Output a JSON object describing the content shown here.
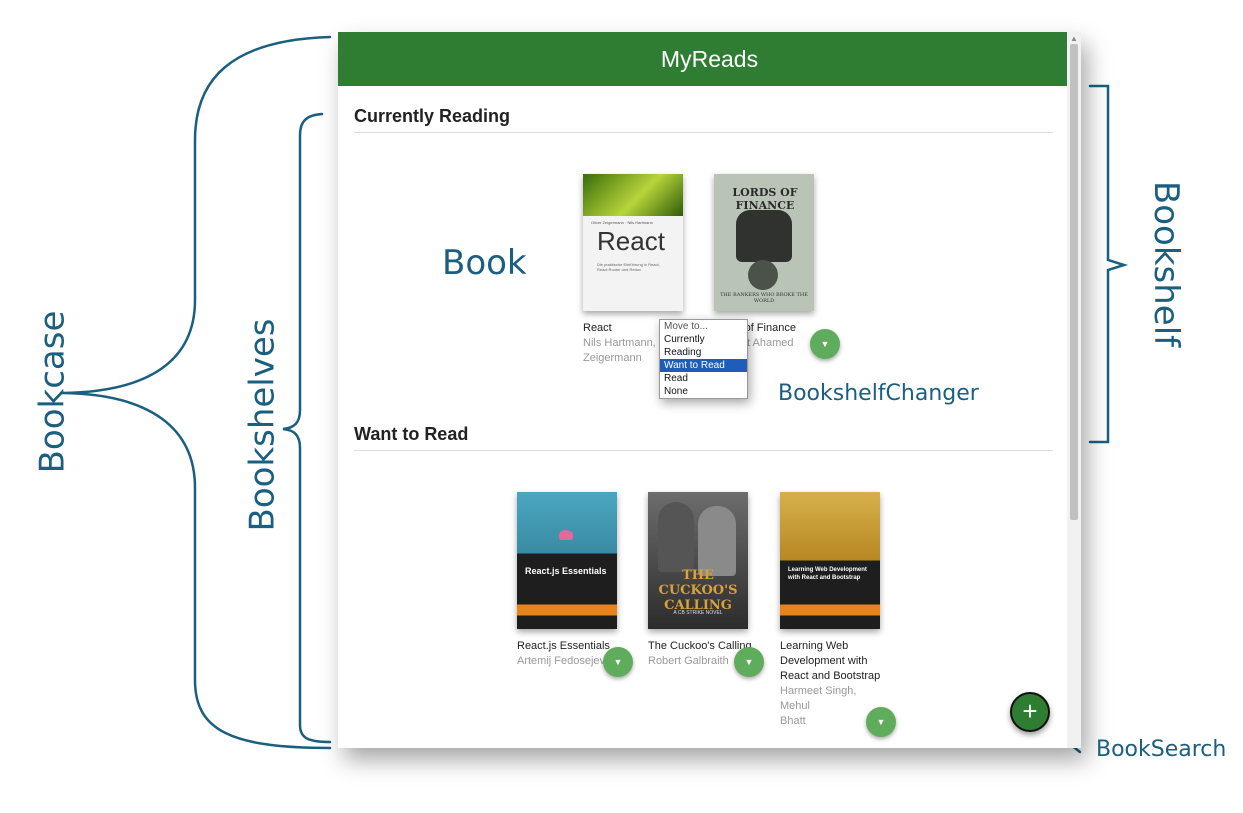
{
  "app": {
    "title": "MyReads"
  },
  "shelves": [
    {
      "title": "Currently Reading"
    },
    {
      "title": "Want to Read"
    }
  ],
  "books": {
    "react": {
      "title": "React",
      "authors": [
        "Nils Hartmann, Oliver",
        "Zeigermann"
      ],
      "cover_brand": "React",
      "cover_subtitle": "Die praktische Einführung in React, React Router und Redux",
      "cover_authors": "Oliver Zeigermann · Nils Hartmann"
    },
    "lords": {
      "title": "Lords of Finance",
      "authors": [
        "Liaquat Ahamed"
      ],
      "cover_title": "LORDS OF FINANCE",
      "cover_subtitle": "THE BANKERS WHO BROKE THE WORLD"
    },
    "reactjs": {
      "title": "React.js Essentials",
      "authors": [
        "Artemij Fedosejev"
      ],
      "cover_title": "React.js Essentials"
    },
    "cuckoo": {
      "title": "The Cuckoo's Calling",
      "authors": [
        "Robert Galbraith"
      ],
      "cover_title": "THE CUCKOO'S CALLING",
      "cover_subtitle": "A CB STRIKE NOVEL"
    },
    "learning": {
      "title": "Learning Web Development with React and Bootstrap",
      "authors": [
        "Harmeet Singh, Mehul",
        "Bhatt"
      ],
      "cover_title": "Learning Web Development with React and Bootstrap"
    }
  },
  "dropdown": {
    "header": "Move to...",
    "options": [
      "Currently Reading",
      "Want to Read",
      "Read",
      "None"
    ],
    "selected": "Want to Read"
  },
  "annotations": {
    "bookcase": "Bookcase",
    "bookshelves": "Bookshelves",
    "book": "Book",
    "bookshelf": "Bookshelf",
    "changer": "BookshelfChanger",
    "search": "BookSearch"
  },
  "fab": {
    "label": "+"
  },
  "colors": {
    "header_green": "#2e7d32",
    "changer_green": "#60ac5d",
    "annotation_blue": "#1b5f80",
    "selected_blue": "#1e5db8"
  }
}
